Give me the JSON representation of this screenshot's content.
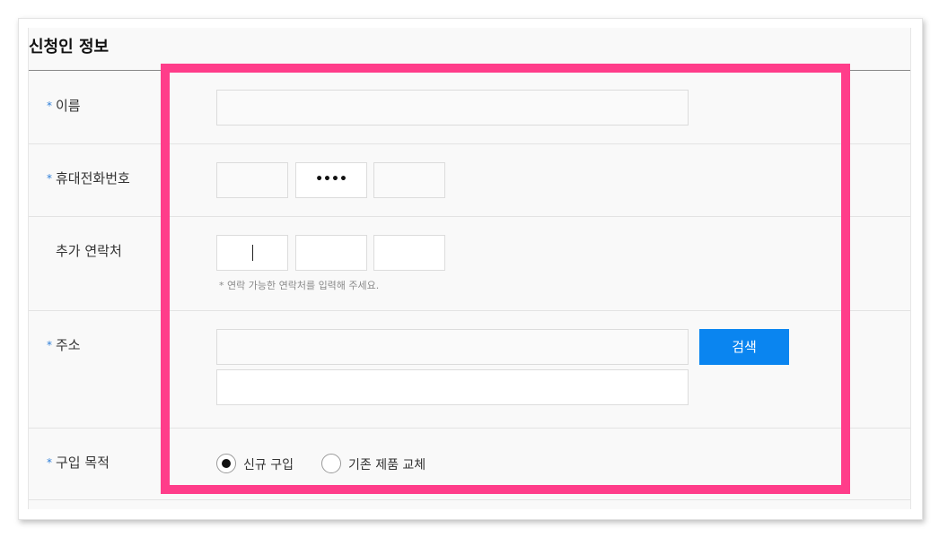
{
  "section": {
    "title": "신청인 정보"
  },
  "fields": {
    "name": {
      "label": "이름",
      "required": true,
      "value": ""
    },
    "mobile": {
      "label": "휴대전화번호",
      "required": true,
      "part1": "",
      "part2": "••••",
      "part3": ""
    },
    "extra_contact": {
      "label": "추가 연락처",
      "required": false,
      "part1": "",
      "part2": "",
      "part3": "",
      "hint": "* 연락 가능한 연락처를 입력해 주세요."
    },
    "address": {
      "label": "주소",
      "required": true,
      "line1": "",
      "line2": "",
      "search_button": "검색"
    },
    "purpose": {
      "label": "구입 목적",
      "required": true,
      "options": [
        "신규 구입",
        "기존 제품 교체"
      ],
      "selected": "신규 구입"
    }
  },
  "required_mark": "*",
  "colors": {
    "highlight": "#ff3d8a",
    "button": "#0a85f0",
    "required_star": "#2f7fd8"
  }
}
